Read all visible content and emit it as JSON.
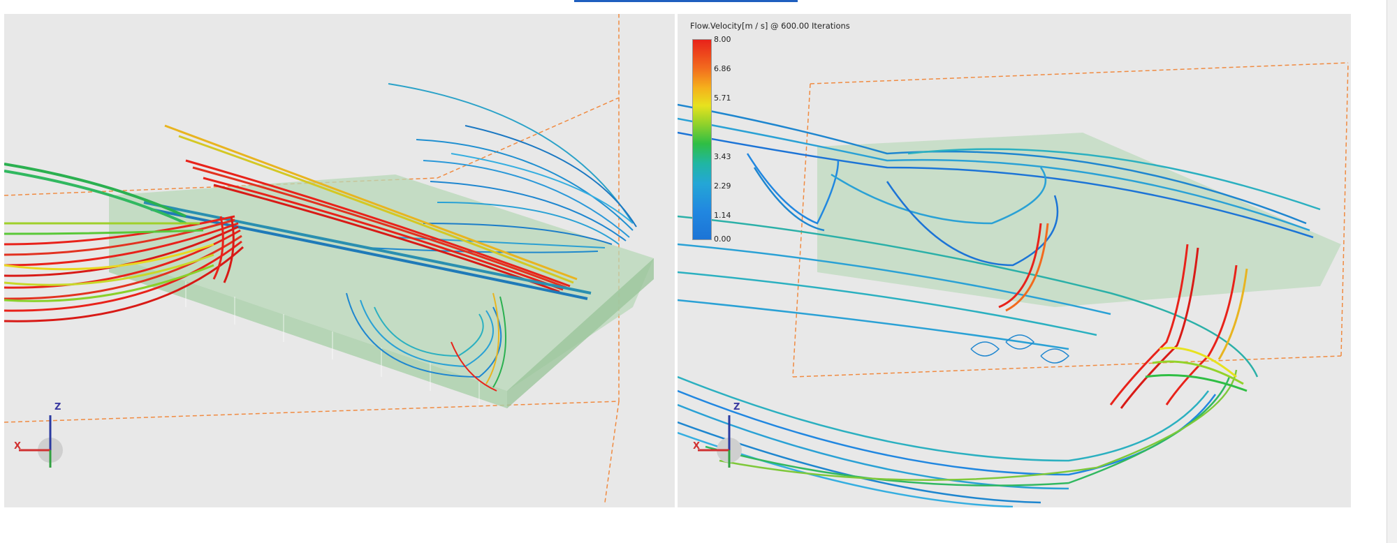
{
  "legend": {
    "title": "Flow.Velocity[m / s] @ 600.00 Iterations",
    "ticks": [
      "8.00",
      "6.86",
      "5.71",
      "3.43",
      "2.29",
      "1.14",
      "0.00"
    ]
  },
  "axes": {
    "z_label": "Z",
    "x_label": "X"
  },
  "colors": {
    "viewport_bg": "#e8e8e8",
    "domain_outline": "#f08a40",
    "building": "#9fcf9f",
    "high_velocity": "#e8221a",
    "low_velocity": "#1c74d6"
  },
  "icons": [
    "axis-triad-icon",
    "axis-triad-icon"
  ]
}
